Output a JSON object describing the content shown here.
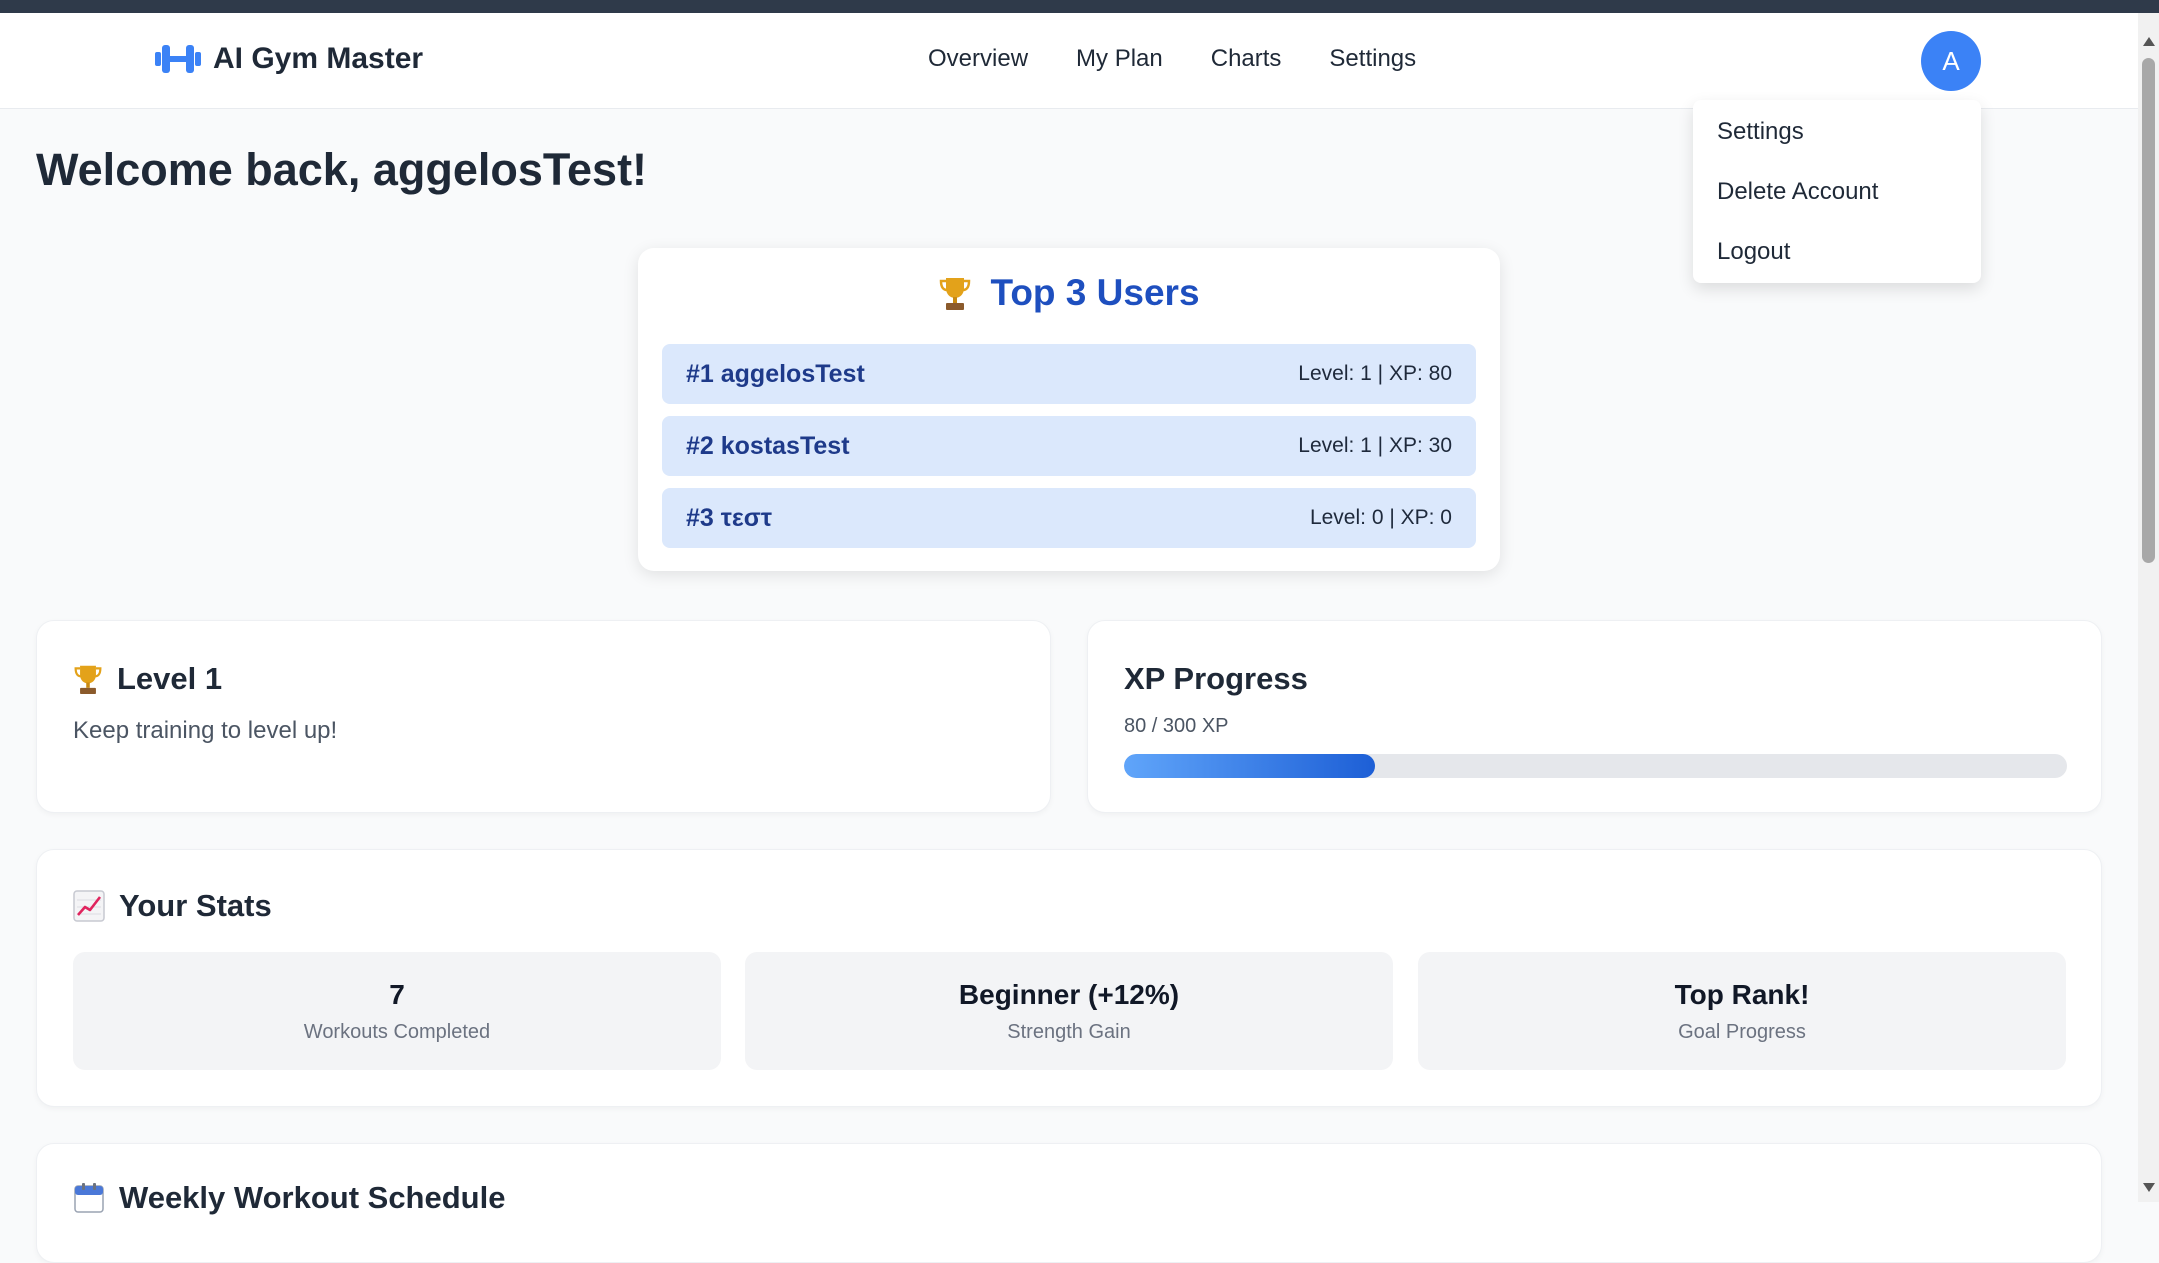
{
  "app": {
    "name": "AI Gym Master",
    "logo_icon": "dumbbell-icon",
    "accent": "#3b82f6"
  },
  "nav": {
    "links": [
      "Overview",
      "My Plan",
      "Charts",
      "Settings"
    ]
  },
  "user_menu": {
    "avatar_letter": "A",
    "items": [
      "Settings",
      "Delete Account",
      "Logout"
    ]
  },
  "welcome": "Welcome back, aggelosTest!",
  "top_users": {
    "icon": "trophy-icon",
    "title": "Top 3 Users",
    "rows": [
      {
        "rank_name": "#1 aggelosTest",
        "stats": "Level: 1 | XP: 80"
      },
      {
        "rank_name": "#2 kostasTest",
        "stats": "Level: 1 | XP: 30"
      },
      {
        "rank_name": "#3 τεστ",
        "stats": "Level: 0 | XP: 0"
      }
    ]
  },
  "level_card": {
    "icon": "trophy-icon",
    "title": "Level 1",
    "subtitle": "Keep training to level up!"
  },
  "xp_card": {
    "title": "XP Progress",
    "text": "80 / 300 XP",
    "current": 80,
    "max": 300
  },
  "stats": {
    "icon": "chart-increasing-icon",
    "title": "Your Stats",
    "items": [
      {
        "value": "7",
        "label": "Workouts Completed"
      },
      {
        "value": "Beginner (+12%)",
        "label": "Strength Gain"
      },
      {
        "value": "Top Rank!",
        "label": "Goal Progress"
      }
    ]
  },
  "schedule": {
    "icon": "calendar-icon",
    "title": "Weekly Workout Schedule"
  }
}
